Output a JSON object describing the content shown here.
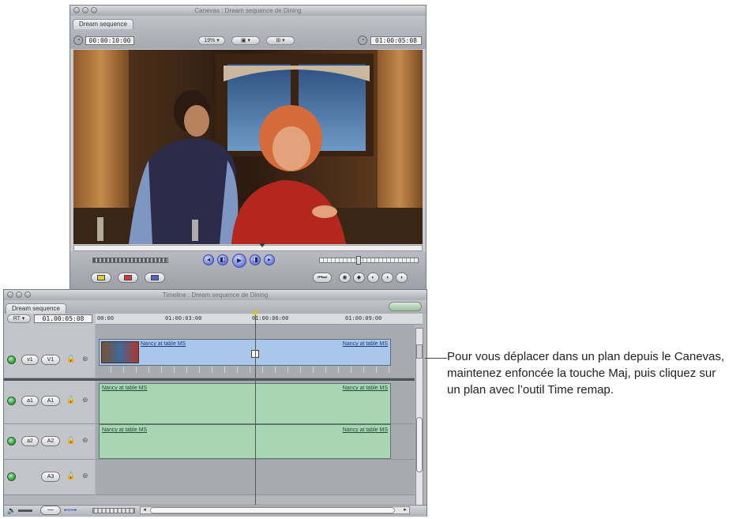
{
  "canvas": {
    "title": "Canevas : Dream sequence de Dining",
    "tab": "Dream sequence",
    "duration": "00:00:10:00",
    "zoom": "19%",
    "view_menu": "",
    "overlay_menu": "",
    "current_timecode": "01:00:05:08"
  },
  "timeline": {
    "title": "Timeline : Dream sequence de Dining",
    "tab": "Dream sequence",
    "rt_menu": "RT",
    "current_timecode": "01.00:05:08",
    "ruler": [
      "00:00",
      "01:00:03:00",
      "01:00:06:00",
      "01:00:09:00"
    ],
    "tracks": [
      {
        "source": "v1",
        "dest": "V1",
        "clip_left": "Nancy at table MS",
        "clip_right": "Nancy at table MS"
      },
      {
        "source": "a1",
        "dest": "A1",
        "clip_left": "Nancy at table MS",
        "clip_right": "Nancy at table MS"
      },
      {
        "source": "a2",
        "dest": "A2",
        "clip_left": "Nancy at table MS",
        "clip_right": "Nancy at table MS"
      },
      {
        "source": "",
        "dest": "A3",
        "clip_left": "",
        "clip_right": ""
      }
    ]
  },
  "callout": {
    "text": "Pour vous déplacer dans un plan depuis le Canevas, maintenez enfoncée la touche Maj, puis cliquez sur un plan avec l’outil Time remap."
  },
  "icons": {
    "lock": "lock-icon",
    "speaker": "speaker-icon",
    "transport": [
      "prev-edit-icon",
      "play-in-out-icon",
      "play-icon",
      "play-around-icon",
      "next-edit-icon"
    ]
  }
}
